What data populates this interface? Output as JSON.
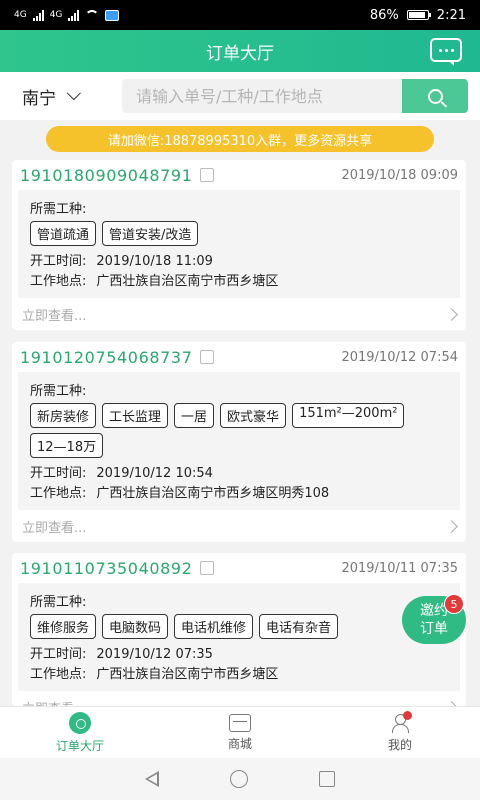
{
  "status_bar": {
    "network_1": "4G",
    "network_2": "4G",
    "battery": "86%",
    "time": "2:21"
  },
  "header": {
    "title": "订单大厅"
  },
  "search": {
    "city": "南宁",
    "placeholder": "请输入单号/工种/工作地点"
  },
  "banner": {
    "text": "请加微信:18878995310入群，更多资源共享"
  },
  "labels": {
    "trade": "所需工种:",
    "start_time": "开工时间:",
    "location": "工作地点:",
    "view_more": "立即查看..."
  },
  "orders": [
    {
      "order_no": "1910180909048791",
      "posted_at": "2019/10/18 09:09",
      "tags": [
        "管道疏通",
        "管道安装/改造"
      ],
      "start_time": "2019/10/18 11:09",
      "location": "广西壮族自治区南宁市西乡塘区"
    },
    {
      "order_no": "1910120754068737",
      "posted_at": "2019/10/12 07:54",
      "tags": [
        "新房装修",
        "工长监理",
        "一居",
        "欧式豪华",
        "151m²—200m²",
        "12—18万"
      ],
      "start_time": "2019/10/12 10:54",
      "location": "广西壮族自治区南宁市西乡塘区明秀108"
    },
    {
      "order_no": "1910110735040892",
      "posted_at": "2019/10/11 07:35",
      "tags": [
        "维修服务",
        "电脑数码",
        "电话机维修",
        "电话有杂音"
      ],
      "start_time": "2019/10/12 07:35",
      "location": "广西壮族自治区南宁市西乡塘区"
    }
  ],
  "invite": {
    "line1": "邀约",
    "line2": "订单",
    "badge": "5"
  },
  "tabbar": {
    "items": [
      {
        "label": "订单大厅",
        "icon": "compass-icon"
      },
      {
        "label": "商城",
        "icon": "shop-icon"
      },
      {
        "label": "我的",
        "icon": "user-icon"
      }
    ]
  },
  "colors": {
    "primary": "#2fbb83",
    "banner": "#f6c22b",
    "badge": "#e03a3a"
  }
}
